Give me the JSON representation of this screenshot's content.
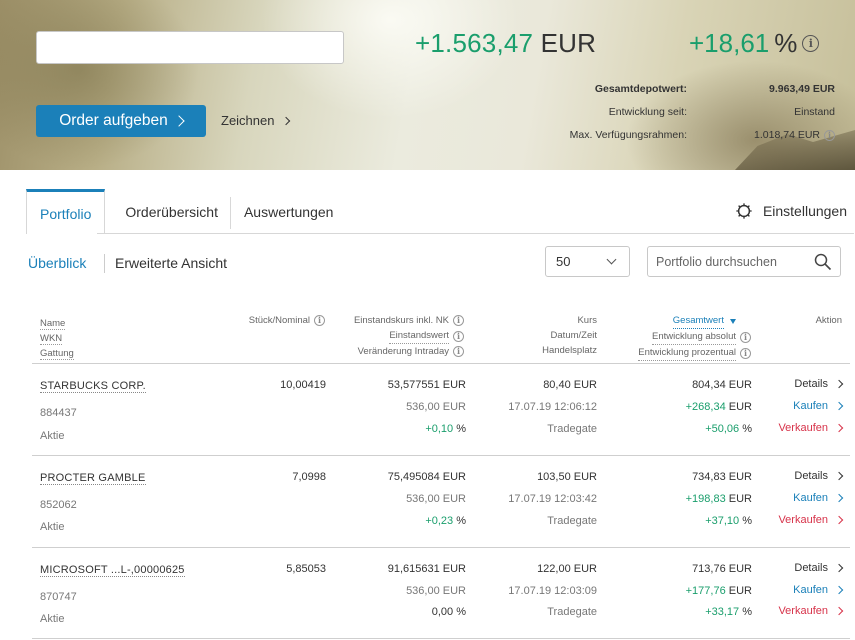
{
  "header": {
    "order_button": "Order aufgeben",
    "sign_link": "Zeichnen",
    "total_change_abs": "+1.563,47",
    "total_change_abs_unit": "EUR",
    "total_change_pct": "+18,61",
    "total_change_pct_unit": "%",
    "summary": [
      {
        "label": "Gesamtdepotwert:",
        "value": "9.963,49 EUR"
      },
      {
        "label": "Entwicklung seit:",
        "value": "Einstand"
      },
      {
        "label": "Max. Verfügungsrahmen:",
        "value": "1.018,74 EUR"
      }
    ]
  },
  "tabs": [
    {
      "label": "Portfolio"
    },
    {
      "label": "Orderübersicht"
    },
    {
      "label": "Auswertungen"
    }
  ],
  "settings_label": "Einstellungen",
  "views": {
    "overview": "Überblick",
    "extended": "Erweiterte Ansicht"
  },
  "page_size": "50",
  "search_placeholder": "Portfolio durchsuchen",
  "columns": {
    "name": [
      "Name",
      "WKN",
      "Gattung"
    ],
    "qty": "Stück/Nominal",
    "cost": [
      "Einstandskurs inkl. NK",
      "Einstandswert",
      "Veränderung Intraday"
    ],
    "price": [
      "Kurs",
      "Datum/Zeit",
      "Handelsplatz"
    ],
    "total": [
      "Gesamtwert",
      "Entwicklung absolut",
      "Entwicklung prozentual"
    ],
    "action": "Aktion"
  },
  "positions": [
    {
      "name": "STARBUCKS CORP.",
      "wkn": "884437",
      "type": "Aktie",
      "qty": "10,00419",
      "cost_price": "53,577551 EUR",
      "cost_value": "536,00 EUR",
      "intraday": "+0,10",
      "intraday_unit": "%",
      "price": "80,40 EUR",
      "datetime": "17.07.19 12:06:12",
      "venue": "Tradegate",
      "total": "804,34 EUR",
      "dev_abs": "+268,34",
      "dev_abs_unit": "EUR",
      "dev_pct": "+50,06",
      "dev_pct_unit": "%"
    },
    {
      "name": "PROCTER GAMBLE",
      "wkn": "852062",
      "type": "Aktie",
      "qty": "7,0998",
      "cost_price": "75,495084 EUR",
      "cost_value": "536,00 EUR",
      "intraday": "+0,23",
      "intraday_unit": "%",
      "price": "103,50 EUR",
      "datetime": "17.07.19 12:03:42",
      "venue": "Tradegate",
      "total": "734,83 EUR",
      "dev_abs": "+198,83",
      "dev_abs_unit": "EUR",
      "dev_pct": "+37,10",
      "dev_pct_unit": "%"
    },
    {
      "name": "MICROSOFT ...L-,00000625",
      "wkn": "870747",
      "type": "Aktie",
      "qty": "5,85053",
      "cost_price": "91,615631 EUR",
      "cost_value": "536,00 EUR",
      "intraday": "0,00",
      "intraday_unit": "%",
      "price": "122,00 EUR",
      "datetime": "17.07.19 12:03:09",
      "venue": "Tradegate",
      "total": "713,76 EUR",
      "dev_abs": "+177,76",
      "dev_abs_unit": "EUR",
      "dev_pct": "+33,17",
      "dev_pct_unit": "%"
    }
  ],
  "actions": {
    "details": "Details",
    "buy": "Kaufen",
    "sell": "Verkaufen"
  },
  "colors": {
    "accent": "#1b80b9",
    "positive": "#1a9e6c",
    "sell": "#d7334a"
  }
}
